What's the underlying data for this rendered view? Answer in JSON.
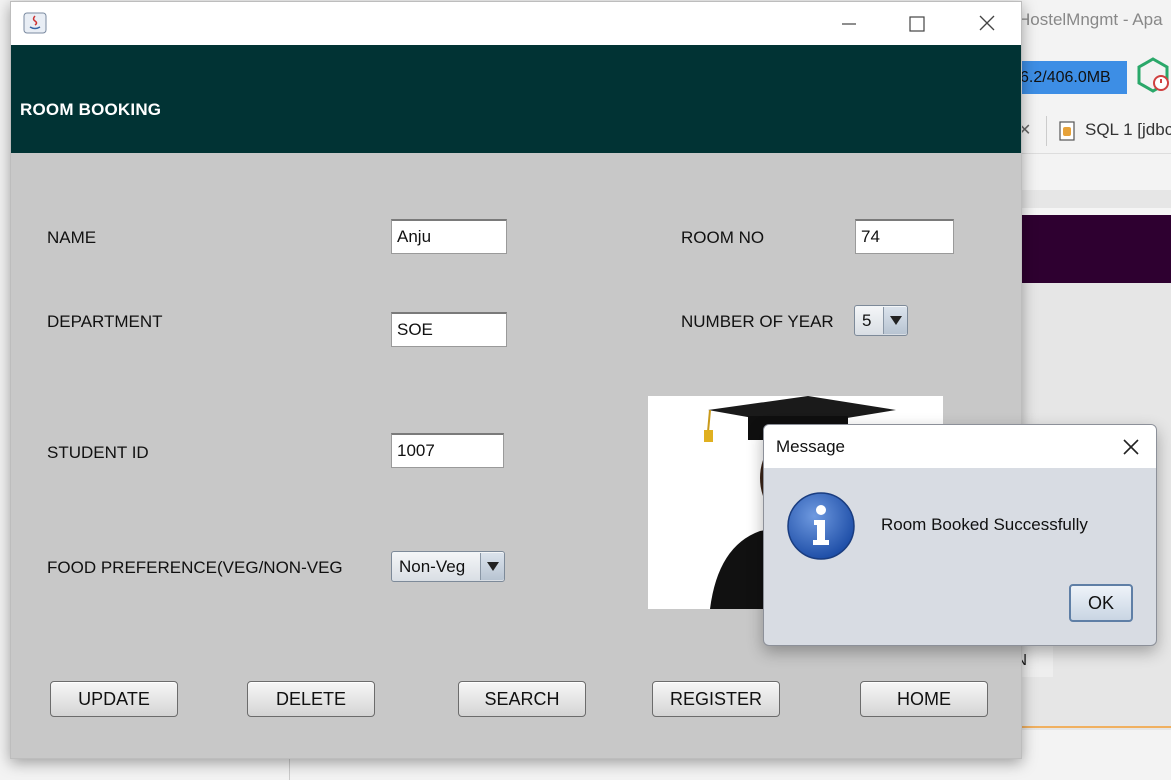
{
  "background": {
    "ide_title": "HostelMngmt - Apa",
    "memory_usage": "6.2/406.0MB",
    "tab_label": "SQL 1 [jdbc",
    "partial_button_text": "N"
  },
  "window": {
    "header_title": "ROOM BOOKING",
    "brand_color": "#013334"
  },
  "form": {
    "name_label": "NAME",
    "name_value": "Anju",
    "department_label": "DEPARTMENT",
    "department_value": "SOE",
    "student_id_label": "STUDENT ID",
    "student_id_value": "1007",
    "food_label": "FOOD PREFERENCE(VEG/NON-VEG",
    "food_value": "Non-Veg",
    "room_no_label": "ROOM NO",
    "room_no_value": "74",
    "years_label": "NUMBER OF YEAR",
    "years_value": "5"
  },
  "buttons": {
    "update": "UPDATE",
    "delete": "DELETE",
    "search": "SEARCH",
    "register": "REGISTER",
    "home": "HOME"
  },
  "dialog": {
    "title": "Message",
    "message": "Room Booked Successfully",
    "ok_label": "OK",
    "icon": "info-icon"
  }
}
